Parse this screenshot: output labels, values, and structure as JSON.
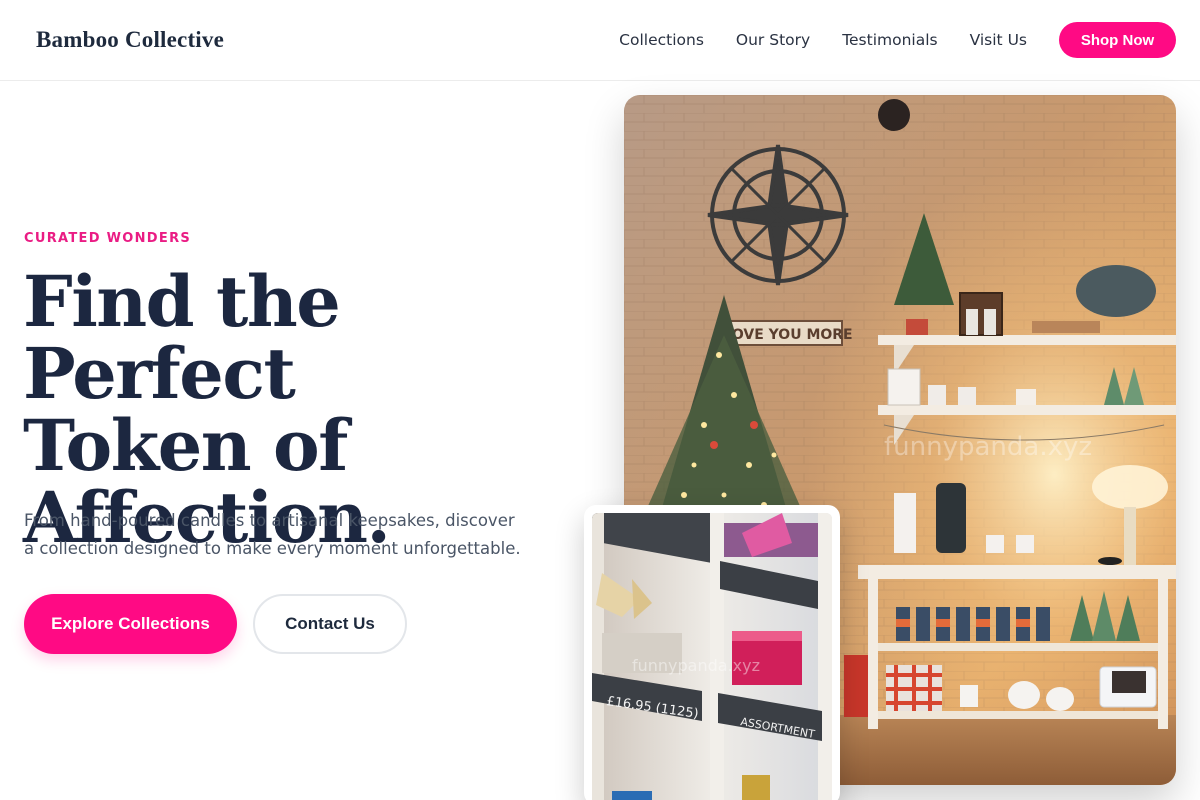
{
  "header": {
    "brand": "Bamboo Collective",
    "nav": [
      "Collections",
      "Our Story",
      "Testimonials",
      "Visit Us"
    ],
    "cta": "Shop Now"
  },
  "hero": {
    "eyebrow": "CURATED WONDERS",
    "headline_lines": [
      "Find the Perfect",
      "Token of",
      "Affection."
    ],
    "subtext_lines": [
      "From hand-poured candles to artisanal keepsakes, discover",
      "a collection designed to make every moment unforgettable."
    ],
    "primary_button": "Explore Collections",
    "secondary_button": "Contact Us"
  },
  "main_image": {
    "sign_text": "I LOVE YOU MORE",
    "watermark": "funnypanda.xyz"
  },
  "secondary_image": {
    "price_tag": "£16.95 (1125)",
    "label_assortment": "ASSORTMENT",
    "watermark": "funnypanda.xyz"
  },
  "colors": {
    "accent": "#ff0a84",
    "heading": "#1c2740",
    "body_text": "#4a5566"
  }
}
